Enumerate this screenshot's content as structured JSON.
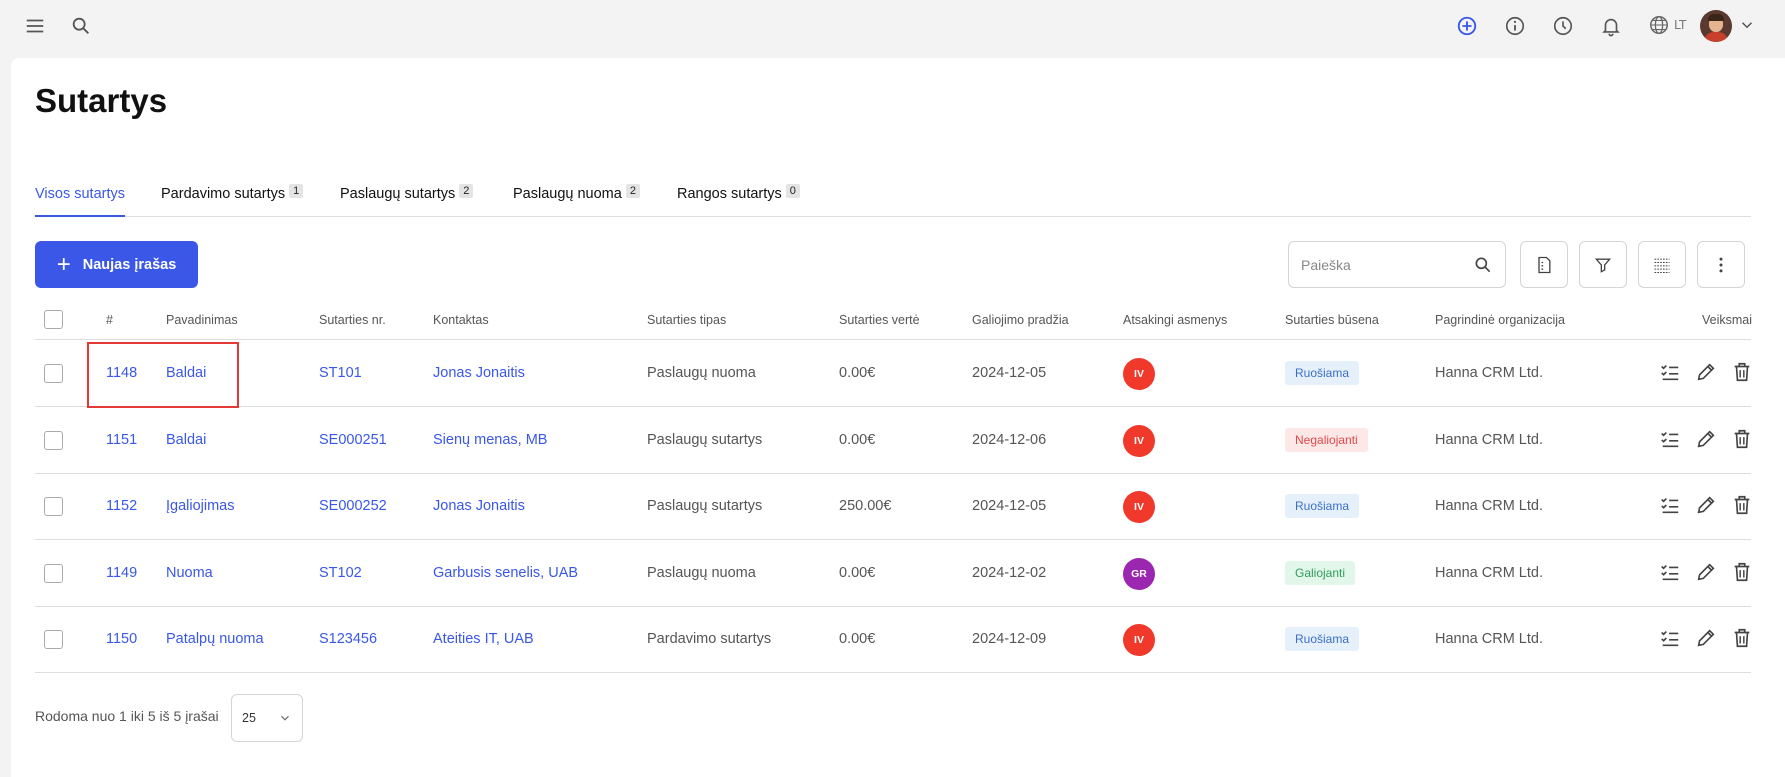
{
  "topbar": {
    "icons": [
      "menu-icon",
      "search-icon",
      "add-circle-icon",
      "info-icon",
      "clock-icon",
      "bell-icon",
      "globe-icon"
    ],
    "language": "LT",
    "accent": "#3a57e8"
  },
  "page": {
    "title": "Sutartys"
  },
  "tabs": [
    {
      "label": "Visos sutartys",
      "count": null,
      "active": true
    },
    {
      "label": "Pardavimo sutartys",
      "count": "1"
    },
    {
      "label": "Paslaugų sutartys",
      "count": "2"
    },
    {
      "label": "Paslaugų nuoma",
      "count": "2"
    },
    {
      "label": "Rangos sutartys",
      "count": "0"
    }
  ],
  "toolbar": {
    "new_label": "Naujas įrašas",
    "search_placeholder": "Paieška"
  },
  "table": {
    "headers": {
      "id": "#",
      "name": "Pavadinimas",
      "number": "Sutarties nr.",
      "contact": "Kontaktas",
      "type": "Sutarties tipas",
      "value": "Sutarties vertė",
      "start": "Galiojimo pradžia",
      "responsible": "Atsakingi asmenys",
      "status": "Sutarties būsena",
      "org": "Pagrindinė organizacija",
      "actions": "Veiksmai"
    },
    "rows": [
      {
        "id": "1148",
        "name": "Baldai",
        "number": "ST101",
        "contact": "Jonas Jonaitis",
        "type": "Paslaugų nuoma",
        "value": "0.00€",
        "start": "2024-12-05",
        "responsible": "IV",
        "responsible_color": "#f0392b",
        "status": "Ruošiama",
        "status_bg": "#e6f0fb",
        "status_fg": "#3a6fc9",
        "org": "Hanna CRM Ltd."
      },
      {
        "id": "1151",
        "name": "Baldai",
        "number": "SE000251",
        "contact": "Sienų menas, MB",
        "type": "Paslaugų sutartys",
        "value": "0.00€",
        "start": "2024-12-06",
        "responsible": "IV",
        "responsible_color": "#f0392b",
        "status": "Negaliojanti",
        "status_bg": "#fde8e8",
        "status_fg": "#e04848",
        "org": "Hanna CRM Ltd."
      },
      {
        "id": "1152",
        "name": "Įgaliojimas",
        "number": "SE000252",
        "contact": "Jonas Jonaitis",
        "type": "Paslaugų sutartys",
        "value": "250.00€",
        "start": "2024-12-05",
        "responsible": "IV",
        "responsible_color": "#f0392b",
        "status": "Ruošiama",
        "status_bg": "#e6f0fb",
        "status_fg": "#3a6fc9",
        "org": "Hanna CRM Ltd."
      },
      {
        "id": "1149",
        "name": "Nuoma",
        "number": "ST102",
        "contact": "Garbusis senelis, UAB",
        "type": "Paslaugų nuoma",
        "value": "0.00€",
        "start": "2024-12-02",
        "responsible": "GR",
        "responsible_color": "#9b27b0",
        "status": "Galiojanti",
        "status_bg": "#e3f6ea",
        "status_fg": "#2f9e5b",
        "org": "Hanna CRM Ltd."
      },
      {
        "id": "1150",
        "name": "Patalpų nuoma",
        "number": "S123456",
        "contact": "Ateities IT, UAB",
        "type": "Pardavimo sutartys",
        "value": "0.00€",
        "start": "2024-12-09",
        "responsible": "IV",
        "responsible_color": "#f0392b",
        "status": "Ruošiama",
        "status_bg": "#e6f0fb",
        "status_fg": "#3a6fc9",
        "org": "Hanna CRM Ltd."
      }
    ],
    "row_action_icons": [
      "checklist-icon",
      "pencil-icon",
      "trash-icon"
    ]
  },
  "footer": {
    "summary": "Rodoma nuo 1 iki 5 iš 5 įrašai",
    "per_page": "25"
  }
}
